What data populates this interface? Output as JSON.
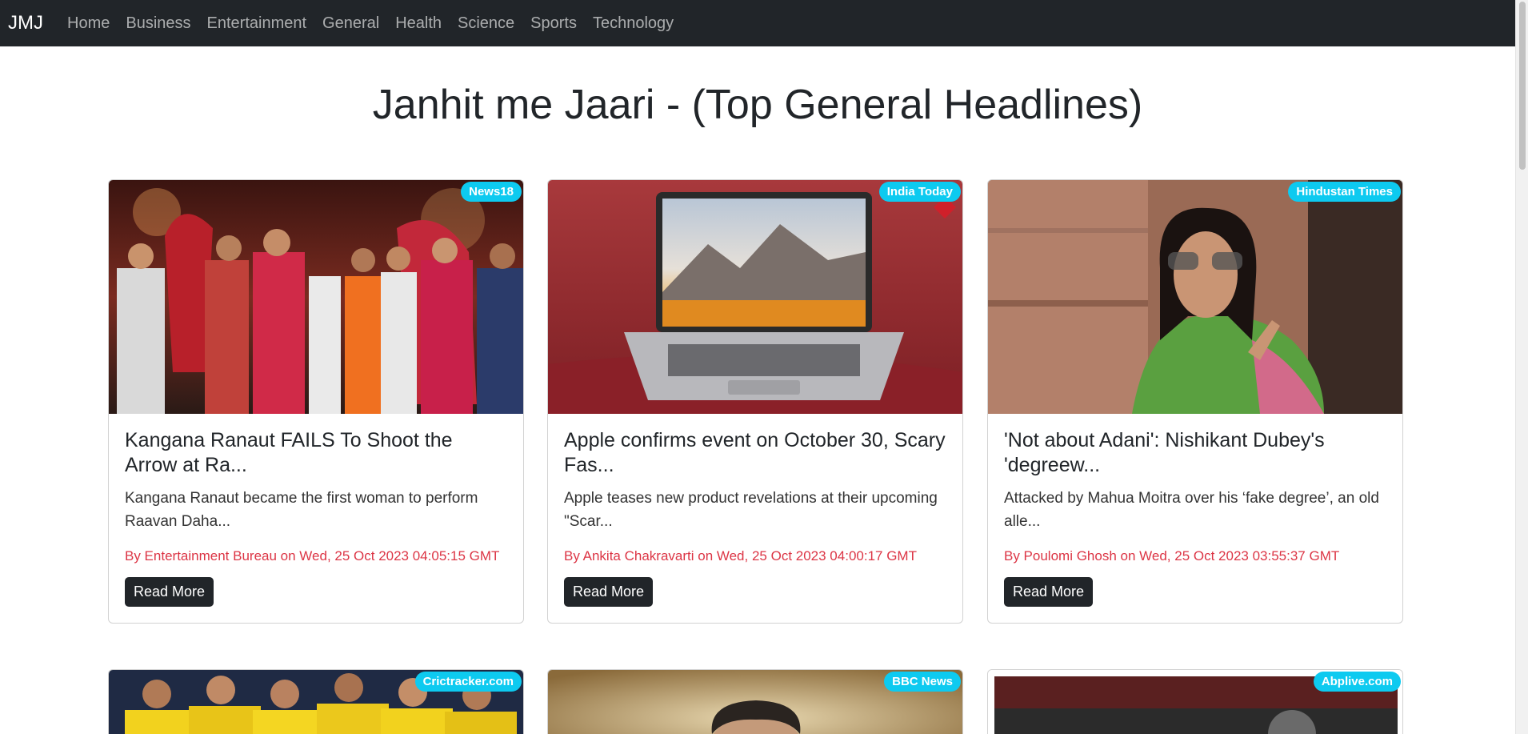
{
  "nav": {
    "brand": "JMJ",
    "links": [
      "Home",
      "Business",
      "Entertainment",
      "General",
      "Health",
      "Science",
      "Sports",
      "Technology"
    ]
  },
  "page": {
    "title": "Janhit me Jaari - (Top General Headlines)"
  },
  "articles": [
    {
      "source": "News18",
      "title": "Kangana Ranaut FAILS To Shoot the Arrow at Ra...",
      "description": "Kangana Ranaut became the first woman to perform Raavan Daha...",
      "meta": "By Entertainment Bureau on Wed, 25 Oct 2023 04:05:15 GMT",
      "button": "Read More"
    },
    {
      "source": "India Today",
      "title": "Apple confirms event on October 30, Scary Fas...",
      "description": "Apple teases new product revelations at their upcoming \"Scar...",
      "meta": "By Ankita Chakravarti on Wed, 25 Oct 2023 04:00:17 GMT",
      "button": "Read More"
    },
    {
      "source": "Hindustan Times",
      "title": "'Not about Adani': Nishikant Dubey's 'degreew...",
      "description": "Attacked by Mahua Moitra over his ‘fake degree’, an old alle...",
      "meta": "By Poulomi Ghosh on Wed, 25 Oct 2023 03:55:37 GMT",
      "button": "Read More"
    },
    {
      "source": "Crictracker.com"
    },
    {
      "source": "BBC News"
    },
    {
      "source": "Abplive.com"
    }
  ],
  "colors": {
    "navbar": "#212529",
    "badge": "#0dcaf0",
    "meta": "#dc3545",
    "button": "#212529"
  }
}
